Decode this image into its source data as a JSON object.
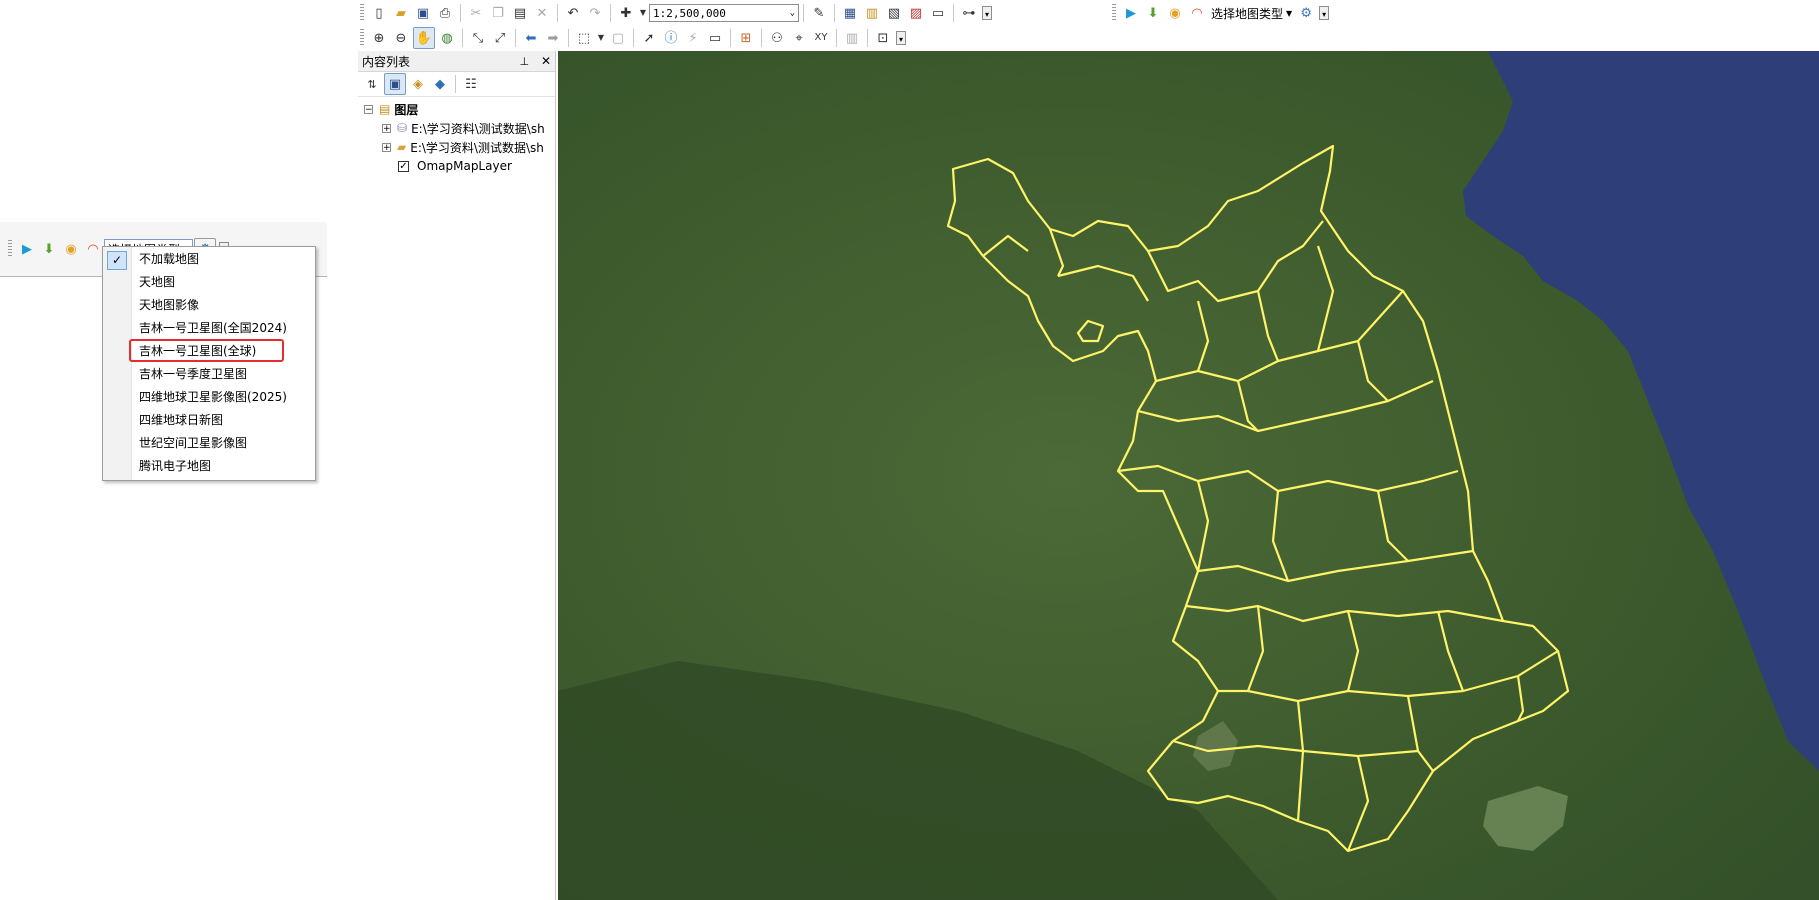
{
  "toolbar_top": {
    "scale_value": "1:2,500,000",
    "map_type_label": "选择地图类型"
  },
  "toc": {
    "title": "内容列表",
    "pin_icon": "pin-icon",
    "close_icon": "close-icon",
    "root_label": "图层",
    "layers": [
      {
        "label": "E:\\学习资料\\测试数据\\sh",
        "icon": "database-icon",
        "expander": "+"
      },
      {
        "label": "E:\\学习资料\\测试数据\\sh",
        "icon": "folder-icon",
        "expander": "+"
      },
      {
        "label": "OmapMapLayer",
        "checked": true
      }
    ]
  },
  "floating_toolbar": {
    "map_type_label": "选择地图类型"
  },
  "map_type_menu": {
    "items": [
      {
        "label": "不加载地图",
        "checked": true
      },
      {
        "label": "天地图"
      },
      {
        "label": "天地图影像"
      },
      {
        "label": "吉林一号卫星图(全国2024)"
      },
      {
        "label": "吉林一号卫星图(全球)",
        "highlighted": true
      },
      {
        "label": "吉林一号季度卫星图"
      },
      {
        "label": "四维地球卫星影像图(2025)"
      },
      {
        "label": "四维地球日新图"
      },
      {
        "label": "世纪空间卫星影像图"
      },
      {
        "label": "腾讯电子地图"
      }
    ]
  },
  "colors": {
    "sea": "#2f3f7a",
    "land": "#3f5a2e",
    "boundary": "#fff36a",
    "highlight_border": "#e52d2d",
    "checked_bg": "#cfe4f8"
  }
}
